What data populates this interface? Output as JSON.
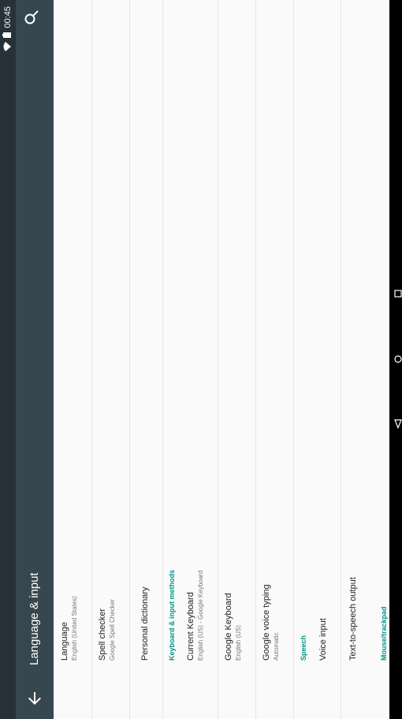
{
  "status": {
    "time": "00:45"
  },
  "toolbar": {
    "title": "Language & input"
  },
  "items": [
    {
      "title": "Language",
      "summary": "English (United States)"
    },
    {
      "title": "Spell checker",
      "summary": "Google Spell Checker"
    },
    {
      "title": "Personal dictionary",
      "summary": ""
    },
    {
      "title": "Current Keyboard",
      "summary": "English (US) - Google Keyboard"
    },
    {
      "title": "Google Keyboard",
      "summary": "English (US)"
    },
    {
      "title": "Google voice typing",
      "summary": "Automatic"
    },
    {
      "title": "Voice input",
      "summary": ""
    },
    {
      "title": "Text-to-speech output",
      "summary": ""
    }
  ],
  "headers": {
    "keyboard": "Keyboard & input methods",
    "speech": "Speech",
    "mouse": "Mouse/trackpad"
  },
  "icons": {
    "back": "back-arrow-icon",
    "search": "search-icon",
    "wifi": "wifi-icon",
    "battery": "battery-icon",
    "nav_back": "nav-back-icon",
    "nav_home": "nav-home-icon",
    "nav_recent": "nav-recent-icon"
  },
  "colors": {
    "statusbar": "#263238",
    "toolbar": "#37474f",
    "accent": "#009688"
  }
}
